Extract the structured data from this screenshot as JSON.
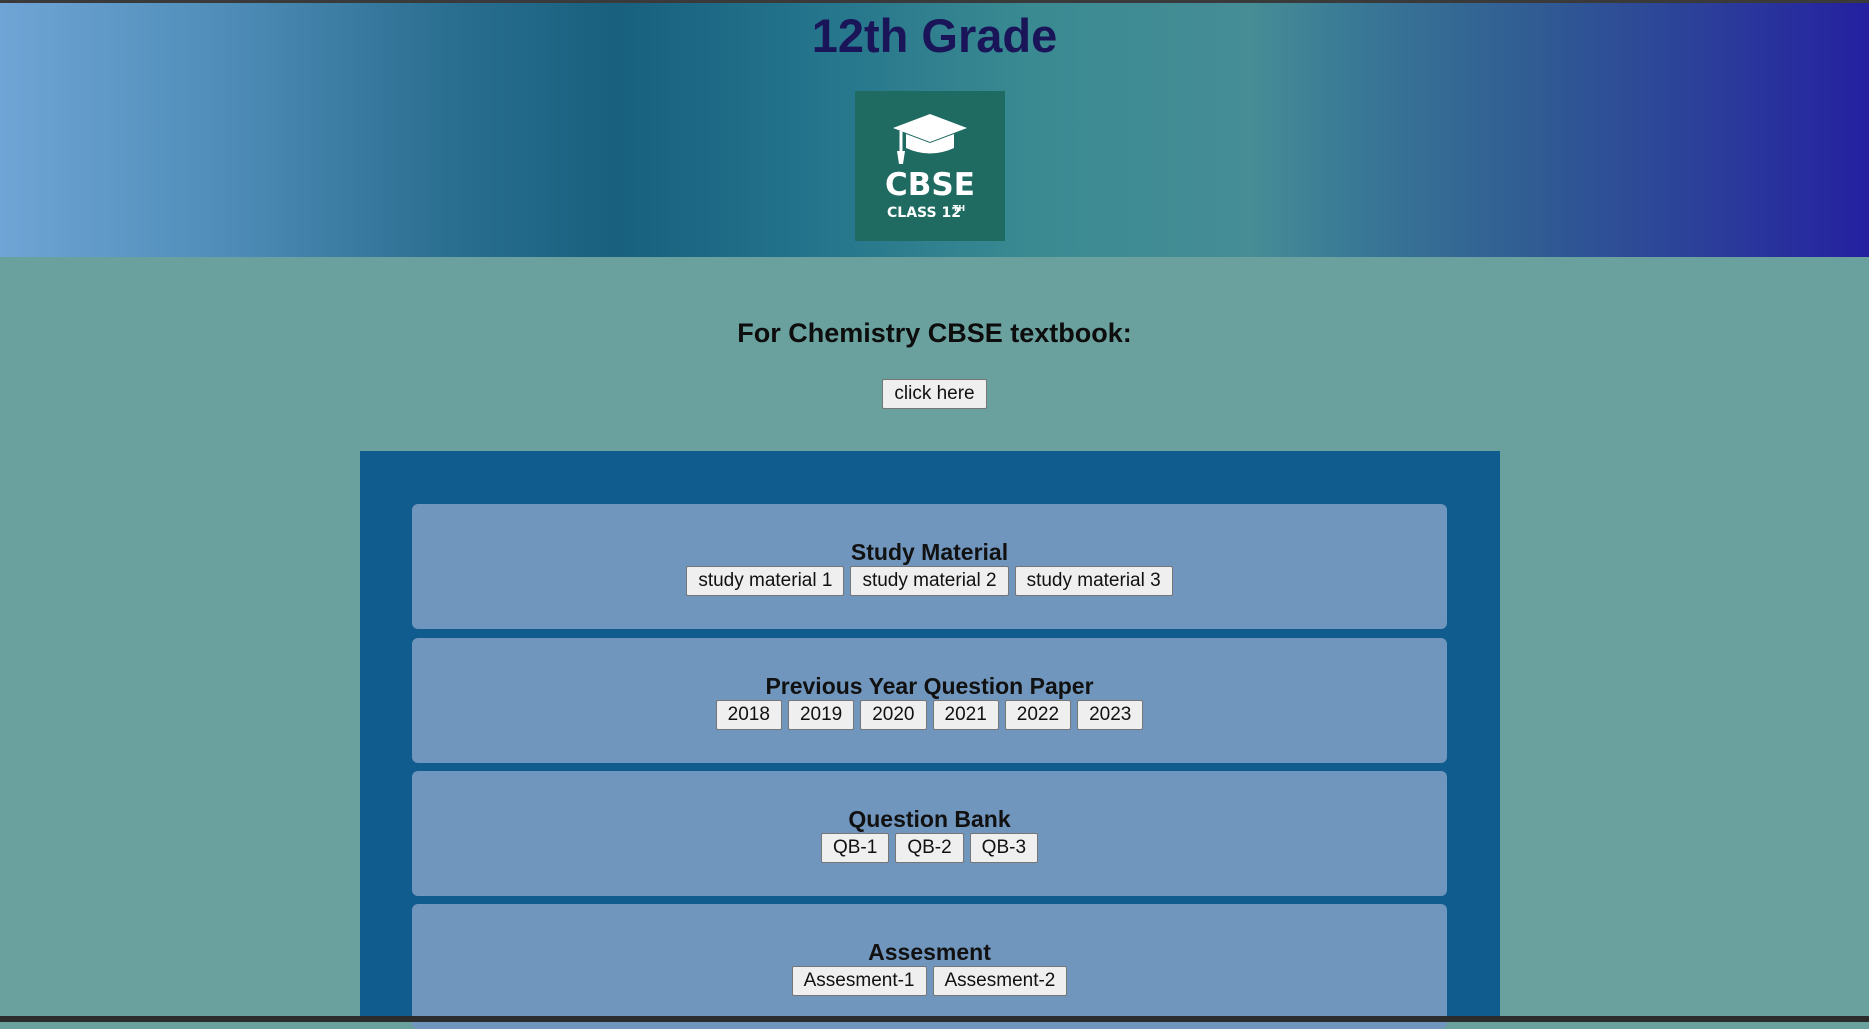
{
  "header": {
    "title": "12th Grade",
    "logo": {
      "brand": "CBSE",
      "subtitle": "CLASS 12",
      "superscript": "TH",
      "icon": "graduation-cap-icon"
    }
  },
  "textbook": {
    "heading": "For Chemistry CBSE textbook:",
    "button_label": "click here"
  },
  "sections": [
    {
      "title": "Study Material",
      "buttons": [
        "study material 1",
        "study material 2",
        "study material 3"
      ]
    },
    {
      "title": "Previous Year Question Paper",
      "buttons": [
        "2018",
        "2019",
        "2020",
        "2021",
        "2022",
        "2023"
      ]
    },
    {
      "title": "Question Bank",
      "buttons": [
        "QB-1",
        "QB-2",
        "QB-3"
      ]
    },
    {
      "title": "Assesment",
      "buttons": [
        "Assesment-1",
        "Assesment-2"
      ]
    }
  ],
  "colors": {
    "page_background": "#6aa09e",
    "panel": "#105c8e",
    "card": "#7196bd",
    "title": "#1a1458",
    "logo_background": "#1f6b62"
  }
}
